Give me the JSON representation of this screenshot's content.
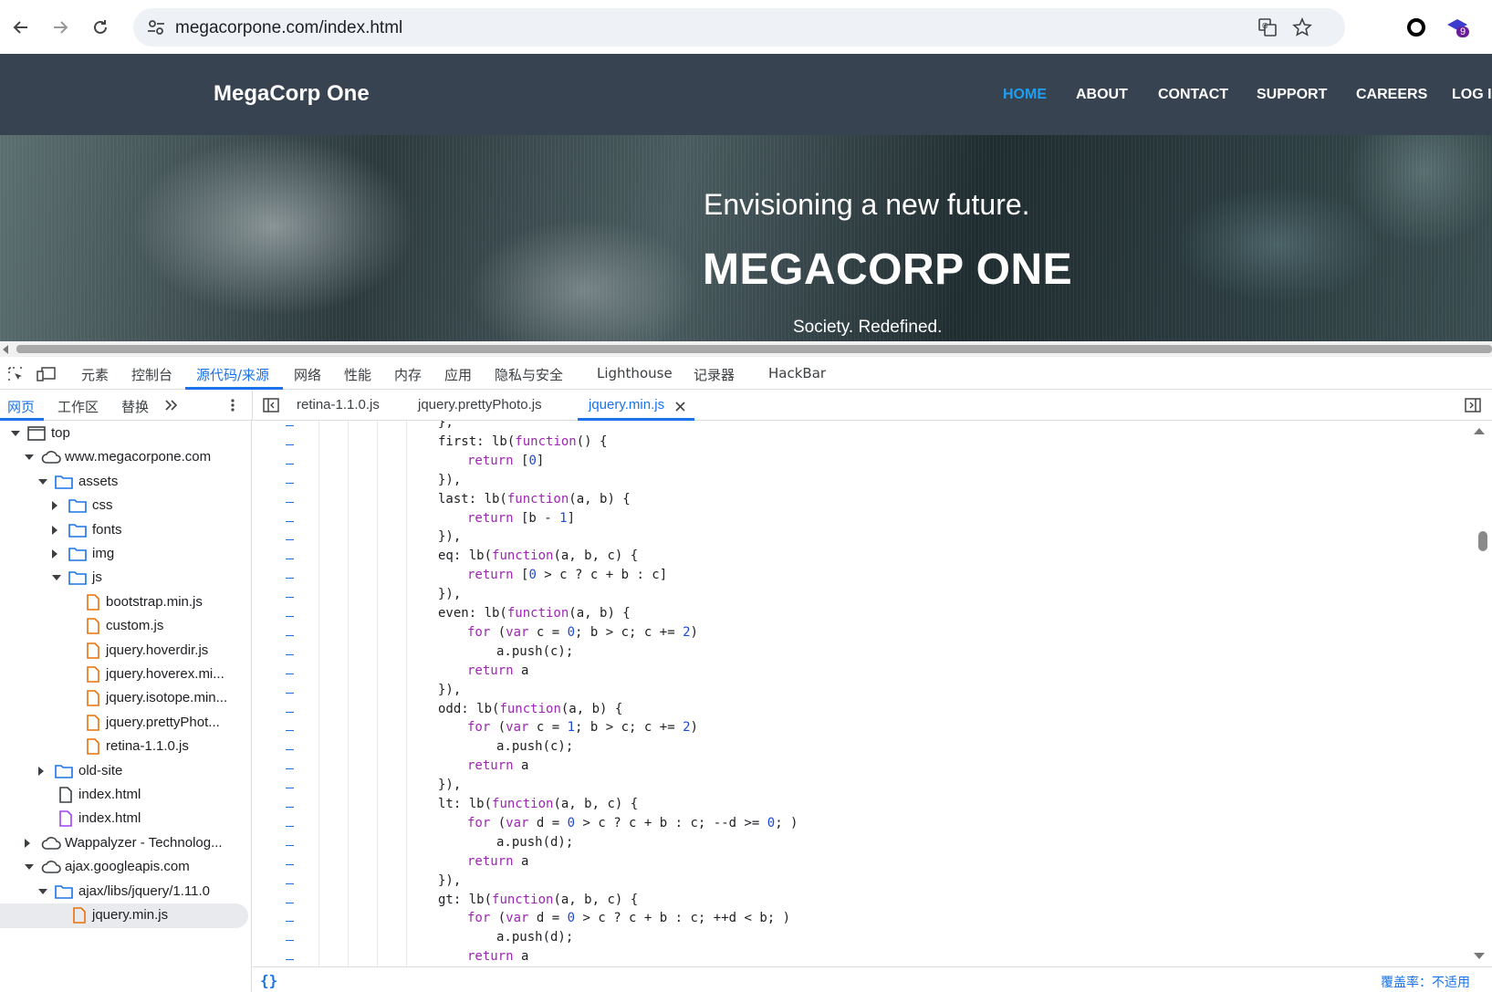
{
  "browser": {
    "url": "megacorpone.com/index.html",
    "extension_badge": "9"
  },
  "site": {
    "logo": "MegaCorp One",
    "nav": [
      "HOME",
      "ABOUT",
      "CONTACT",
      "SUPPORT",
      "CAREERS",
      "LOG IN"
    ],
    "active_nav": "HOME",
    "hero_subtitle": "Envisioning a new future.",
    "hero_title": "MEGACORP ONE",
    "hero_tagline": "Society. Redefined."
  },
  "devtools": {
    "tabs": [
      "元素",
      "控制台",
      "源代码/来源",
      "网络",
      "性能",
      "内存",
      "应用",
      "隐私与安全",
      "Lighthouse",
      "记录器",
      "HackBar"
    ],
    "active_tab": "源代码/来源",
    "sub_tabs": [
      "网页",
      "工作区",
      "替换"
    ],
    "active_sub_tab": "网页",
    "file_tabs": [
      "retina-1.1.0.js",
      "jquery.prettyPhoto.js",
      "jquery.min.js"
    ],
    "active_file_tab": "jquery.min.js",
    "tree": [
      {
        "label": "top",
        "depth": 0,
        "icon": "frame-icon",
        "arrow": "down"
      },
      {
        "label": "www.megacorpone.com",
        "depth": 1,
        "icon": "cloud-icon",
        "arrow": "down"
      },
      {
        "label": "assets",
        "depth": 2,
        "icon": "folder-icon",
        "arrow": "down"
      },
      {
        "label": "css",
        "depth": 3,
        "icon": "folder-icon",
        "arrow": "right"
      },
      {
        "label": "fonts",
        "depth": 3,
        "icon": "folder-icon",
        "arrow": "right"
      },
      {
        "label": "img",
        "depth": 3,
        "icon": "folder-icon",
        "arrow": "right"
      },
      {
        "label": "js",
        "depth": 3,
        "icon": "folder-icon",
        "arrow": "down"
      },
      {
        "label": "bootstrap.min.js",
        "depth": 4,
        "icon": "js-file-icon",
        "arrow": ""
      },
      {
        "label": "custom.js",
        "depth": 4,
        "icon": "js-file-icon",
        "arrow": ""
      },
      {
        "label": "jquery.hoverdir.js",
        "depth": 4,
        "icon": "js-file-icon",
        "arrow": ""
      },
      {
        "label": "jquery.hoverex.mi...",
        "depth": 4,
        "icon": "js-file-icon",
        "arrow": ""
      },
      {
        "label": "jquery.isotope.min...",
        "depth": 4,
        "icon": "js-file-icon",
        "arrow": ""
      },
      {
        "label": "jquery.prettyPhot...",
        "depth": 4,
        "icon": "js-file-icon",
        "arrow": ""
      },
      {
        "label": "retina-1.1.0.js",
        "depth": 4,
        "icon": "js-file-icon",
        "arrow": ""
      },
      {
        "label": "old-site",
        "depth": 2,
        "icon": "folder-icon",
        "arrow": "right"
      },
      {
        "label": "index.html",
        "depth": 2,
        "icon": "html-file-icon",
        "arrow": ""
      },
      {
        "label": "index.html",
        "depth": 2,
        "icon": "html-file-purple-icon",
        "arrow": ""
      },
      {
        "label": "Wappalyzer - Technolog...",
        "depth": 1,
        "icon": "cloud-icon",
        "arrow": "right"
      },
      {
        "label": "ajax.googleapis.com",
        "depth": 1,
        "icon": "cloud-icon",
        "arrow": "down"
      },
      {
        "label": "ajax/libs/jquery/1.11.0",
        "depth": 2,
        "icon": "folder-icon",
        "arrow": "down"
      },
      {
        "label": "jquery.min.js",
        "depth": 3,
        "icon": "js-file-icon",
        "arrow": "",
        "selected": true
      }
    ],
    "code_lines": [
      [
        [
          0,
          "pl",
          "},"
        ]
      ],
      [
        [
          0,
          "pl",
          "first: lb("
        ],
        [
          0,
          "kw",
          "function"
        ],
        [
          0,
          "pl",
          "() {"
        ]
      ],
      [
        [
          1,
          "kw",
          "return"
        ],
        [
          1,
          "pl",
          " ["
        ],
        [
          1,
          "num",
          "0"
        ],
        [
          1,
          "pl",
          "]"
        ]
      ],
      [
        [
          0,
          "pl",
          "}),"
        ]
      ],
      [
        [
          0,
          "pl",
          "last: lb("
        ],
        [
          0,
          "kw",
          "function"
        ],
        [
          0,
          "pl",
          "(a, b) {"
        ]
      ],
      [
        [
          1,
          "kw",
          "return"
        ],
        [
          1,
          "pl",
          " [b - "
        ],
        [
          1,
          "num",
          "1"
        ],
        [
          1,
          "pl",
          "]"
        ]
      ],
      [
        [
          0,
          "pl",
          "}),"
        ]
      ],
      [
        [
          0,
          "pl",
          "eq: lb("
        ],
        [
          0,
          "kw",
          "function"
        ],
        [
          0,
          "pl",
          "(a, b, c) {"
        ]
      ],
      [
        [
          1,
          "kw",
          "return"
        ],
        [
          1,
          "pl",
          " ["
        ],
        [
          1,
          "num",
          "0"
        ],
        [
          1,
          "pl",
          " > c ? c + b : c]"
        ]
      ],
      [
        [
          0,
          "pl",
          "}),"
        ]
      ],
      [
        [
          0,
          "pl",
          "even: lb("
        ],
        [
          0,
          "kw",
          "function"
        ],
        [
          0,
          "pl",
          "(a, b) {"
        ]
      ],
      [
        [
          1,
          "kw",
          "for"
        ],
        [
          1,
          "pl",
          " ("
        ],
        [
          1,
          "kw",
          "var"
        ],
        [
          1,
          "pl",
          " c = "
        ],
        [
          1,
          "num",
          "0"
        ],
        [
          1,
          "pl",
          "; b > c; c += "
        ],
        [
          1,
          "num",
          "2"
        ],
        [
          1,
          "pl",
          ")"
        ]
      ],
      [
        [
          2,
          "pl",
          "a.push(c);"
        ]
      ],
      [
        [
          1,
          "kw",
          "return"
        ],
        [
          1,
          "pl",
          " a"
        ]
      ],
      [
        [
          0,
          "pl",
          "}),"
        ]
      ],
      [
        [
          0,
          "pl",
          "odd: lb("
        ],
        [
          0,
          "kw",
          "function"
        ],
        [
          0,
          "pl",
          "(a, b) {"
        ]
      ],
      [
        [
          1,
          "kw",
          "for"
        ],
        [
          1,
          "pl",
          " ("
        ],
        [
          1,
          "kw",
          "var"
        ],
        [
          1,
          "pl",
          " c = "
        ],
        [
          1,
          "num",
          "1"
        ],
        [
          1,
          "pl",
          "; b > c; c += "
        ],
        [
          1,
          "num",
          "2"
        ],
        [
          1,
          "pl",
          ")"
        ]
      ],
      [
        [
          2,
          "pl",
          "a.push(c);"
        ]
      ],
      [
        [
          1,
          "kw",
          "return"
        ],
        [
          1,
          "pl",
          " a"
        ]
      ],
      [
        [
          0,
          "pl",
          "}),"
        ]
      ],
      [
        [
          0,
          "pl",
          "lt: lb("
        ],
        [
          0,
          "kw",
          "function"
        ],
        [
          0,
          "pl",
          "(a, b, c) {"
        ]
      ],
      [
        [
          1,
          "kw",
          "for"
        ],
        [
          1,
          "pl",
          " ("
        ],
        [
          1,
          "kw",
          "var"
        ],
        [
          1,
          "pl",
          " d = "
        ],
        [
          1,
          "num",
          "0"
        ],
        [
          1,
          "pl",
          " > c ? c + b : c; --d >= "
        ],
        [
          1,
          "num",
          "0"
        ],
        [
          1,
          "pl",
          "; )"
        ]
      ],
      [
        [
          2,
          "pl",
          "a.push(d);"
        ]
      ],
      [
        [
          1,
          "kw",
          "return"
        ],
        [
          1,
          "pl",
          " a"
        ]
      ],
      [
        [
          0,
          "pl",
          "}),"
        ]
      ],
      [
        [
          0,
          "pl",
          "gt: lb("
        ],
        [
          0,
          "kw",
          "function"
        ],
        [
          0,
          "pl",
          "(a, b, c) {"
        ]
      ],
      [
        [
          1,
          "kw",
          "for"
        ],
        [
          1,
          "pl",
          " ("
        ],
        [
          1,
          "kw",
          "var"
        ],
        [
          1,
          "pl",
          " d = "
        ],
        [
          1,
          "num",
          "0"
        ],
        [
          1,
          "pl",
          " > c ? c + b : c; ++d < b; )"
        ]
      ],
      [
        [
          2,
          "pl",
          "a.push(d);"
        ]
      ],
      [
        [
          1,
          "kw",
          "return"
        ],
        [
          1,
          "pl",
          " a"
        ]
      ]
    ],
    "status_brace": "{}",
    "coverage": "覆盖率：不适用"
  },
  "colors": {
    "header_bg": "#374351",
    "accent": "#1a73e8",
    "nav_active": "#1e9ff2",
    "keyword": "#9e26b3",
    "number": "#1c49d8",
    "js_file": "#e8710a",
    "folder": "#1a73e8"
  }
}
